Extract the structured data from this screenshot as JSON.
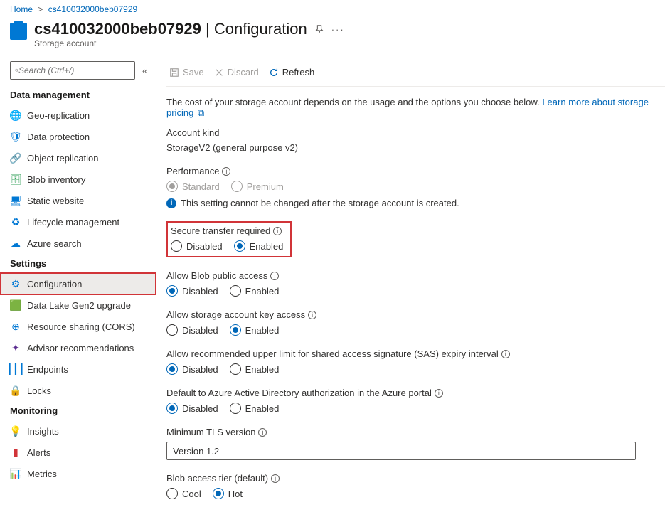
{
  "breadcrumb": {
    "home": "Home",
    "resource": "cs410032000beb07929"
  },
  "header": {
    "title": "cs410032000beb07929",
    "section": "Configuration",
    "subtitle": "Storage account"
  },
  "search": {
    "placeholder": "Search (Ctrl+/)"
  },
  "sidebar": {
    "groups": [
      {
        "title": "Data management",
        "items": [
          {
            "label": "Geo-replication",
            "icon": "globe",
            "color": "#0078d4"
          },
          {
            "label": "Data protection",
            "icon": "shield",
            "color": "#0078d4"
          },
          {
            "label": "Object replication",
            "icon": "replicate",
            "color": "#0078d4"
          },
          {
            "label": "Blob inventory",
            "icon": "inventory",
            "color": "#3aa35f"
          },
          {
            "label": "Static website",
            "icon": "website",
            "color": "#0078d4"
          },
          {
            "label": "Lifecycle management",
            "icon": "lifecycle",
            "color": "#0078d4"
          },
          {
            "label": "Azure search",
            "icon": "cloud",
            "color": "#0078d4"
          }
        ]
      },
      {
        "title": "Settings",
        "items": [
          {
            "label": "Configuration",
            "icon": "gear",
            "color": "#0078d4",
            "active": true,
            "highlight": true
          },
          {
            "label": "Data Lake Gen2 upgrade",
            "icon": "lake",
            "color": "#3aa35f"
          },
          {
            "label": "Resource sharing (CORS)",
            "icon": "cors",
            "color": "#0078d4"
          },
          {
            "label": "Advisor recommendations",
            "icon": "advisor",
            "color": "#5c2e91"
          },
          {
            "label": "Endpoints",
            "icon": "endpoints",
            "color": "#0078d4"
          },
          {
            "label": "Locks",
            "icon": "lock",
            "color": "#323130"
          }
        ]
      },
      {
        "title": "Monitoring",
        "items": [
          {
            "label": "Insights",
            "icon": "insights",
            "color": "#5c2e91"
          },
          {
            "label": "Alerts",
            "icon": "alerts",
            "color": "#d13438"
          },
          {
            "label": "Metrics",
            "icon": "metrics",
            "color": "#0078d4"
          }
        ]
      }
    ]
  },
  "toolbar": {
    "save": "Save",
    "discard": "Discard",
    "refresh": "Refresh"
  },
  "content": {
    "intro": "The cost of your storage account depends on the usage and the options you choose below.",
    "learn_more": "Learn more about storage pricing",
    "account_kind_label": "Account kind",
    "account_kind_value": "StorageV2 (general purpose v2)",
    "perf_label": "Performance",
    "perf_std": "Standard",
    "perf_prem": "Premium",
    "perf_note": "This setting cannot be changed after the storage account is created.",
    "secure_label": "Secure transfer required",
    "blob_pub_label": "Allow Blob public access",
    "key_access_label": "Allow storage account key access",
    "sas_label": "Allow recommended upper limit for shared access signature (SAS) expiry interval",
    "aad_label": "Default to Azure Active Directory authorization in the Azure portal",
    "tls_label": "Minimum TLS version",
    "tls_value": "Version 1.2",
    "tier_label": "Blob access tier (default)",
    "tier_cool": "Cool",
    "tier_hot": "Hot",
    "opt_disabled": "Disabled",
    "opt_enabled": "Enabled"
  }
}
